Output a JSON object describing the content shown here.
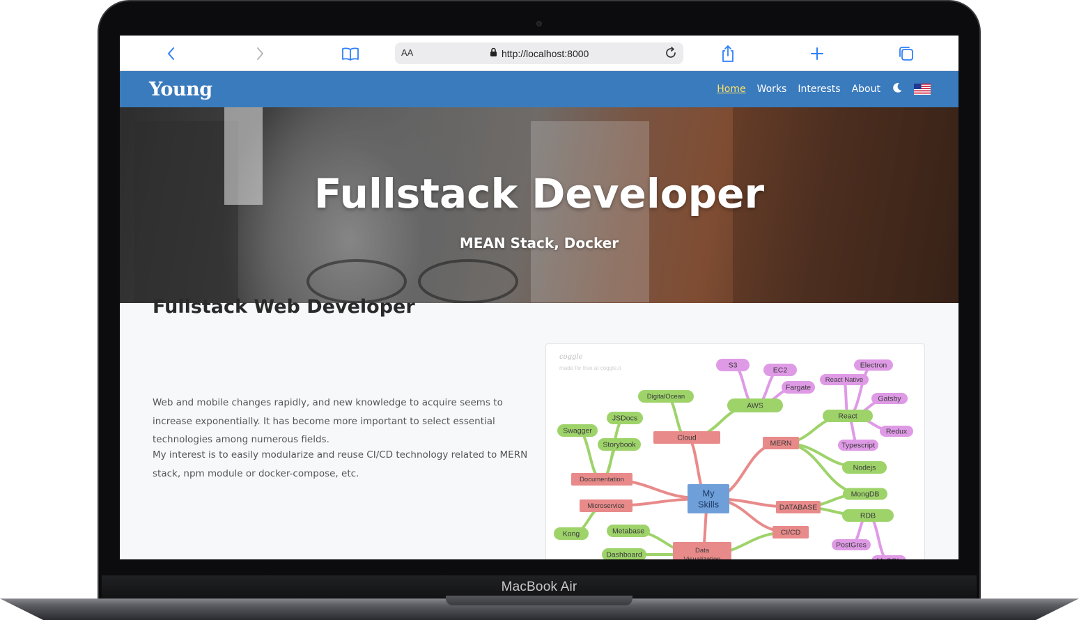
{
  "device": {
    "label": "MacBook Air"
  },
  "browser": {
    "text_size_label": "AA",
    "url": "http://localhost:8000",
    "icons": [
      "chevron-left-icon",
      "chevron-right-icon",
      "bookmarks-icon",
      "lock-icon",
      "reload-icon",
      "share-icon",
      "plus-icon",
      "tabs-icon"
    ]
  },
  "navbar": {
    "brand": "Young",
    "links": [
      {
        "label": "Home",
        "active": true
      },
      {
        "label": "Works",
        "active": false
      },
      {
        "label": "Interests",
        "active": false
      },
      {
        "label": "About",
        "active": false
      }
    ],
    "theme_icon": "moon-icon",
    "language_icon": "us-flag-icon",
    "colors": {
      "background": "#3a7bbd",
      "active_link": "#ffe066"
    }
  },
  "hero": {
    "title": "Fullstack Developer",
    "subtitle": "MEAN Stack, Docker"
  },
  "content": {
    "heading": "Fullstack Web Developer",
    "paragraph_1": "Web and mobile changes rapidly, and new knowledge to acquire seems to increase exponentially. It has become more important to select essential technologies among numerous fields.",
    "paragraph_2": "My interest is to easily modularize and reuse CI/CD technology related to MERN stack, npm module or docker-compose, etc."
  },
  "mindmap": {
    "watermark": "coggle",
    "watermark_sub": "made for free at coggle.it",
    "center": "My Skills",
    "colors": {
      "center": "#6f9fd8",
      "red": "#e98a8a",
      "green": "#9ed36a",
      "purple": "#df9ae6"
    },
    "nodes": [
      {
        "id": "s3",
        "label": "S3",
        "color": "purple"
      },
      {
        "id": "ec2",
        "label": "EC2",
        "color": "purple"
      },
      {
        "id": "fargate",
        "label": "Fargate",
        "color": "purple"
      },
      {
        "id": "electron",
        "label": "Electron",
        "color": "purple"
      },
      {
        "id": "reactnative",
        "label": "React Native",
        "color": "purple"
      },
      {
        "id": "gatsby",
        "label": "Gatsby",
        "color": "purple"
      },
      {
        "id": "redux",
        "label": "Redux",
        "color": "purple"
      },
      {
        "id": "typescript",
        "label": "Typescript",
        "color": "purple"
      },
      {
        "id": "postgres",
        "label": "PostGres",
        "color": "purple"
      },
      {
        "id": "mssql",
        "label": "MsSQL",
        "color": "purple"
      },
      {
        "id": "digitalocean",
        "label": "DigitalOcean",
        "color": "green"
      },
      {
        "id": "aws",
        "label": "AWS",
        "color": "green"
      },
      {
        "id": "jsdocs",
        "label": "JSDocs",
        "color": "green"
      },
      {
        "id": "swagger",
        "label": "Swagger",
        "color": "green"
      },
      {
        "id": "storybook",
        "label": "Storybook",
        "color": "green"
      },
      {
        "id": "react",
        "label": "React",
        "color": "green"
      },
      {
        "id": "nodejs",
        "label": "Nodejs",
        "color": "green"
      },
      {
        "id": "mongodb",
        "label": "MongDB",
        "color": "green"
      },
      {
        "id": "rdb",
        "label": "RDB",
        "color": "green"
      },
      {
        "id": "kong",
        "label": "Kong",
        "color": "green"
      },
      {
        "id": "metabase",
        "label": "Metabase",
        "color": "green"
      },
      {
        "id": "dashboard",
        "label": "Dashboard",
        "color": "green"
      },
      {
        "id": "cloud",
        "label": "Cloud",
        "color": "red"
      },
      {
        "id": "mern",
        "label": "MERN",
        "color": "red"
      },
      {
        "id": "documentation",
        "label": "Documentation",
        "color": "red"
      },
      {
        "id": "microservice",
        "label": "Microservice",
        "color": "red"
      },
      {
        "id": "database",
        "label": "DATABASE",
        "color": "red"
      },
      {
        "id": "cicd",
        "label": "CI/CD",
        "color": "red"
      },
      {
        "id": "dataviz",
        "label": "Data Visualization",
        "color": "red"
      }
    ]
  }
}
